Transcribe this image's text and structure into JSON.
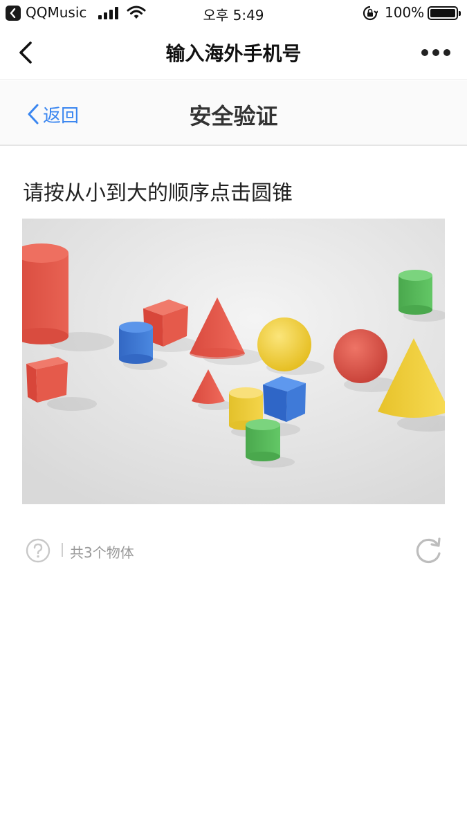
{
  "status_bar": {
    "app_name": "QQMusic",
    "time": "오후 5:49",
    "battery_percent": "100%",
    "battery_level": 1.0
  },
  "nav": {
    "title": "输入海外手机号",
    "back_icon": "chevron-left-icon",
    "more_icon": "more-dots-icon"
  },
  "verify": {
    "back_label": "返回",
    "title": "安全验证",
    "prompt": "请按从小到大的顺序点击圆锥",
    "count_label": "共3个物体"
  },
  "colors": {
    "accent_blue": "#3a86f0",
    "shape_red": "#e25a4a",
    "shape_yellow": "#f2cf3c",
    "shape_blue": "#3a78d6",
    "shape_green": "#5bbf5d"
  }
}
